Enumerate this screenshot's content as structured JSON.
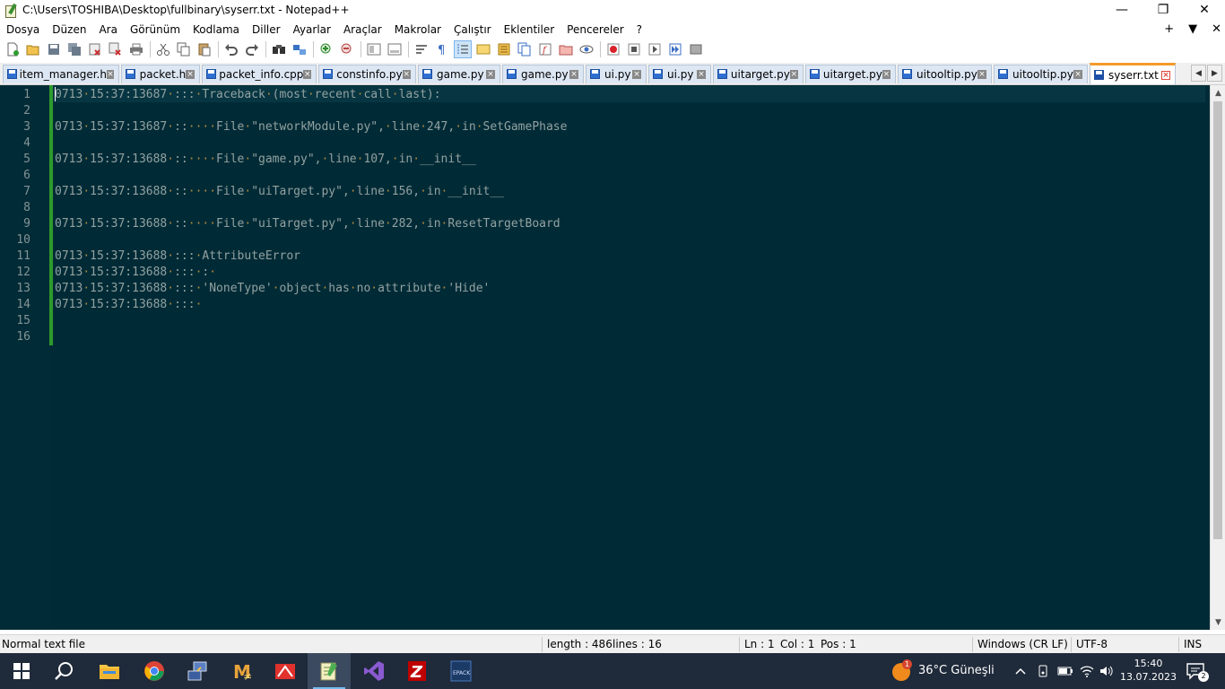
{
  "window": {
    "title": "C:\\Users\\TOSHIBA\\Desktop\\fullbinary\\syserr.txt - Notepad++",
    "controls": [
      "—",
      "❐",
      "✕"
    ]
  },
  "menu": {
    "items": [
      "Dosya",
      "Düzen",
      "Ara",
      "Görünüm",
      "Kodlama",
      "Diller",
      "Ayarlar",
      "Araçlar",
      "Makrolar",
      "Çalıştır",
      "Eklentiler",
      "Pencereler",
      "?"
    ],
    "right": [
      "+",
      "▼",
      "✕"
    ]
  },
  "toolbar": {
    "icons": [
      "new-file-icon",
      "open-file-icon",
      "save-icon",
      "save-all-icon",
      "close-icon",
      "close-all-icon",
      "print-icon",
      "cut-icon",
      "copy-icon",
      "paste-icon",
      "undo-icon",
      "redo-icon",
      "find-icon",
      "replace-icon",
      "zoom-in-icon",
      "zoom-out-icon",
      "sync-v-icon",
      "sync-h-icon",
      "word-wrap-icon",
      "show-all-chars-icon",
      "indent-guide-icon",
      "udl-icon",
      "doc-map-icon",
      "doc-list-icon",
      "function-list-icon",
      "folder-workspace-icon",
      "monitor-icon",
      "record-macro-icon",
      "stop-macro-icon",
      "play-macro-icon",
      "run-macro-multiple-icon",
      "save-macro-icon"
    ]
  },
  "tabs": [
    {
      "label": "item_manager.h",
      "active": false
    },
    {
      "label": "packet.h",
      "active": false
    },
    {
      "label": "packet_info.cpp",
      "active": false
    },
    {
      "label": "constinfo.py",
      "active": false
    },
    {
      "label": "game.py",
      "active": false
    },
    {
      "label": "game.py",
      "active": false
    },
    {
      "label": "ui.py",
      "active": false
    },
    {
      "label": "ui.py",
      "active": false
    },
    {
      "label": "uitarget.py",
      "active": false
    },
    {
      "label": "uitarget.py",
      "active": false
    },
    {
      "label": "uitooltip.py",
      "active": false
    },
    {
      "label": "uitooltip.py",
      "active": false
    },
    {
      "label": "syserr.txt",
      "active": true
    }
  ],
  "editor": {
    "lines": [
      {
        "n": "1",
        "text": "0713·15:37:13687·:::·Traceback·(most·recent·call·last):"
      },
      {
        "n": "2",
        "text": ""
      },
      {
        "n": "3",
        "text": "0713·15:37:13687·::····File·\"networkModule.py\",·line·247,·in·SetGamePhase"
      },
      {
        "n": "4",
        "text": ""
      },
      {
        "n": "5",
        "text": "0713·15:37:13688·::····File·\"game.py\",·line·107,·in·__init__"
      },
      {
        "n": "6",
        "text": ""
      },
      {
        "n": "7",
        "text": "0713·15:37:13688·::····File·\"uiTarget.py\",·line·156,·in·__init__"
      },
      {
        "n": "8",
        "text": ""
      },
      {
        "n": "9",
        "text": "0713·15:37:13688·::····File·\"uiTarget.py\",·line·282,·in·ResetTargetBoard"
      },
      {
        "n": "10",
        "text": ""
      },
      {
        "n": "11",
        "text": "0713·15:37:13688·:::·AttributeError"
      },
      {
        "n": "12",
        "text": "0713·15:37:13688·:::·:·"
      },
      {
        "n": "13",
        "text": "0713·15:37:13688·:::·'NoneType'·object·has·no·attribute·'Hide'"
      },
      {
        "n": "14",
        "text": "0713·15:37:13688·:::·"
      },
      {
        "n": "15",
        "text": ""
      },
      {
        "n": "16",
        "text": ""
      }
    ]
  },
  "statusbar": {
    "file_type": "Normal text file",
    "length": "length : 486",
    "lines": "lines : 16",
    "ln": "Ln : 1",
    "col": "Col : 1",
    "pos": "Pos : 1",
    "eol": "Windows (CR LF)",
    "encoding": "UTF-8",
    "mode": "INS"
  },
  "taskbar": {
    "apps": [
      "windows-start-icon",
      "search-icon",
      "file-explorer-icon",
      "chrome-icon",
      "network-tool-icon",
      "winrar-icon",
      "red-app-icon",
      "notepadpp-icon",
      "visual-studio-icon",
      "filezilla-icon",
      "epack-icon"
    ],
    "weather_badge": "1",
    "weather": "36°C  Güneşli",
    "time": "15:40",
    "date": "13.07.2023",
    "notification_badge": "2"
  },
  "colors": {
    "editor_bg": "#002b36",
    "text": "#93a1a1",
    "whitespace": "#b08840",
    "line_number": "#839496",
    "fold_margin": "#2c9a2c",
    "active_tab_accent": "#f49a2a"
  }
}
